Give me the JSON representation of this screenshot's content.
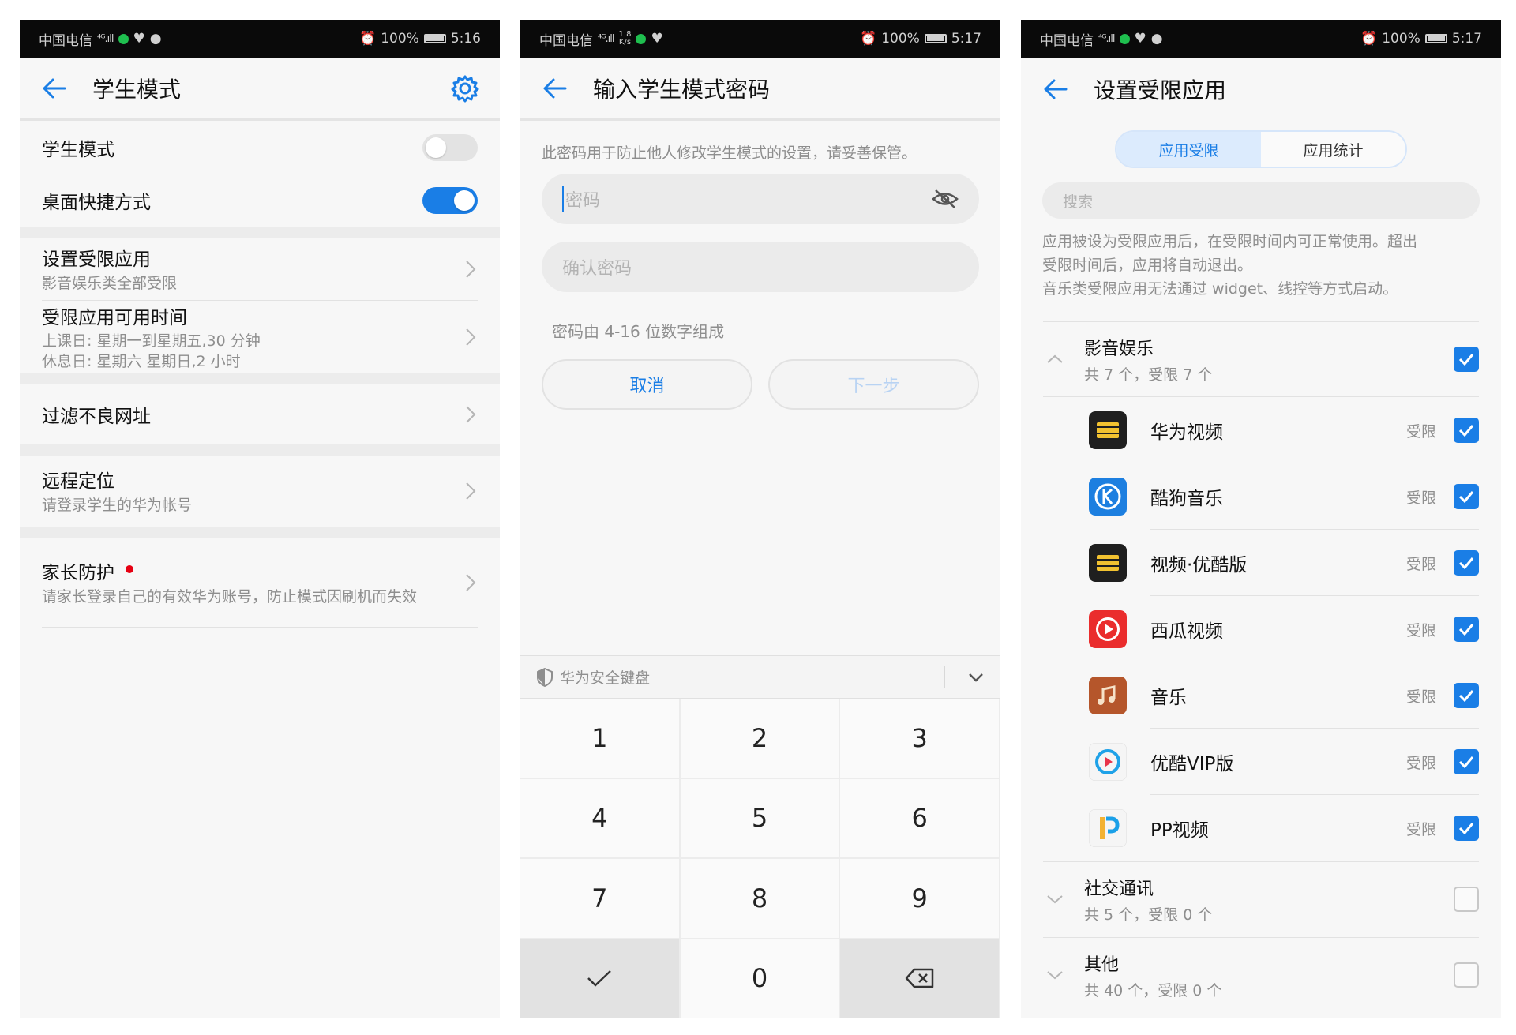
{
  "screens": [
    {
      "status": {
        "carrier": "中国电信",
        "signal": "⁴ᴳ.ıll",
        "alarm": "⏰",
        "battery": "100%",
        "time": "5:16"
      },
      "title": "学生模式",
      "toggles": [
        {
          "label": "学生模式",
          "on": false
        },
        {
          "label": "桌面快捷方式",
          "on": true
        }
      ],
      "items": [
        {
          "label": "设置受限应用",
          "sub": "影音娱乐类全部受限"
        },
        {
          "label": "受限应用可用时间",
          "sub1": "上课日: 星期一到星期五,30 分钟",
          "sub2": "休息日: 星期六 星期日,2 小时"
        },
        {
          "label": "过滤不良网址"
        },
        {
          "label": "远程定位",
          "sub": "请登录学生的华为帐号"
        },
        {
          "label": "家长防护",
          "sub": "请家长登录自己的有效华为账号，防止模式因刷机而失效"
        }
      ]
    },
    {
      "status": {
        "carrier": "中国电信",
        "signal": "⁴ᴳ.ıll",
        "speed_top": "1.8",
        "speed_bottom": "K/s",
        "alarm": "⏰",
        "battery": "100%",
        "time": "5:17"
      },
      "title": "输入学生模式密码",
      "hint": "此密码用于防止他人修改学生模式的设置，请妥善保管。",
      "password_placeholder": "密码",
      "confirm_placeholder": "确认密码",
      "rule": "密码由 4-16 位数字组成",
      "cancel": "取消",
      "next": "下一步",
      "keyboard_label": "华为安全键盘",
      "keys": [
        "1",
        "2",
        "3",
        "4",
        "5",
        "6",
        "7",
        "8",
        "9",
        "0"
      ]
    },
    {
      "status": {
        "carrier": "中国电信",
        "signal": "⁴ᴳ.ıll",
        "alarm": "⏰",
        "battery": "100%",
        "time": "5:17"
      },
      "title": "设置受限应用",
      "tabs": [
        "应用受限",
        "应用统计"
      ],
      "search_placeholder": "搜索",
      "description": [
        "应用被设为受限应用后，在受限时间内可正常使用。超出",
        "受限时间后，应用将自动退出。",
        "音乐类受限应用无法通过 widget、线控等方式启动。"
      ],
      "categories": [
        {
          "name": "影音娱乐",
          "count": "共 7 个，受限 7 个",
          "checked": true
        },
        {
          "name": "社交通讯",
          "count": "共 5 个，受限 0 个",
          "checked": false
        },
        {
          "name": "其他",
          "count": "共 40 个，受限 0 个",
          "checked": false
        }
      ],
      "restricted_tag": "受限",
      "apps": [
        {
          "name": "华为视频",
          "icon": "huawei-video-icon",
          "checked": true
        },
        {
          "name": "酷狗音乐",
          "icon": "kugou-icon",
          "checked": true
        },
        {
          "name": "视频·优酷版",
          "icon": "video-youku-icon",
          "checked": true
        },
        {
          "name": "西瓜视频",
          "icon": "xigua-icon",
          "checked": true
        },
        {
          "name": "音乐",
          "icon": "music-icon",
          "checked": true
        },
        {
          "name": "优酷VIP版",
          "icon": "youku-vip-icon",
          "checked": true
        },
        {
          "name": "PP视频",
          "icon": "pp-video-icon",
          "checked": true
        }
      ]
    }
  ],
  "colors": {
    "accent": "#1a7ee6",
    "status_bar": "#0a0a0a",
    "background": "#f7f7f7",
    "red_dot": "#e60012"
  }
}
